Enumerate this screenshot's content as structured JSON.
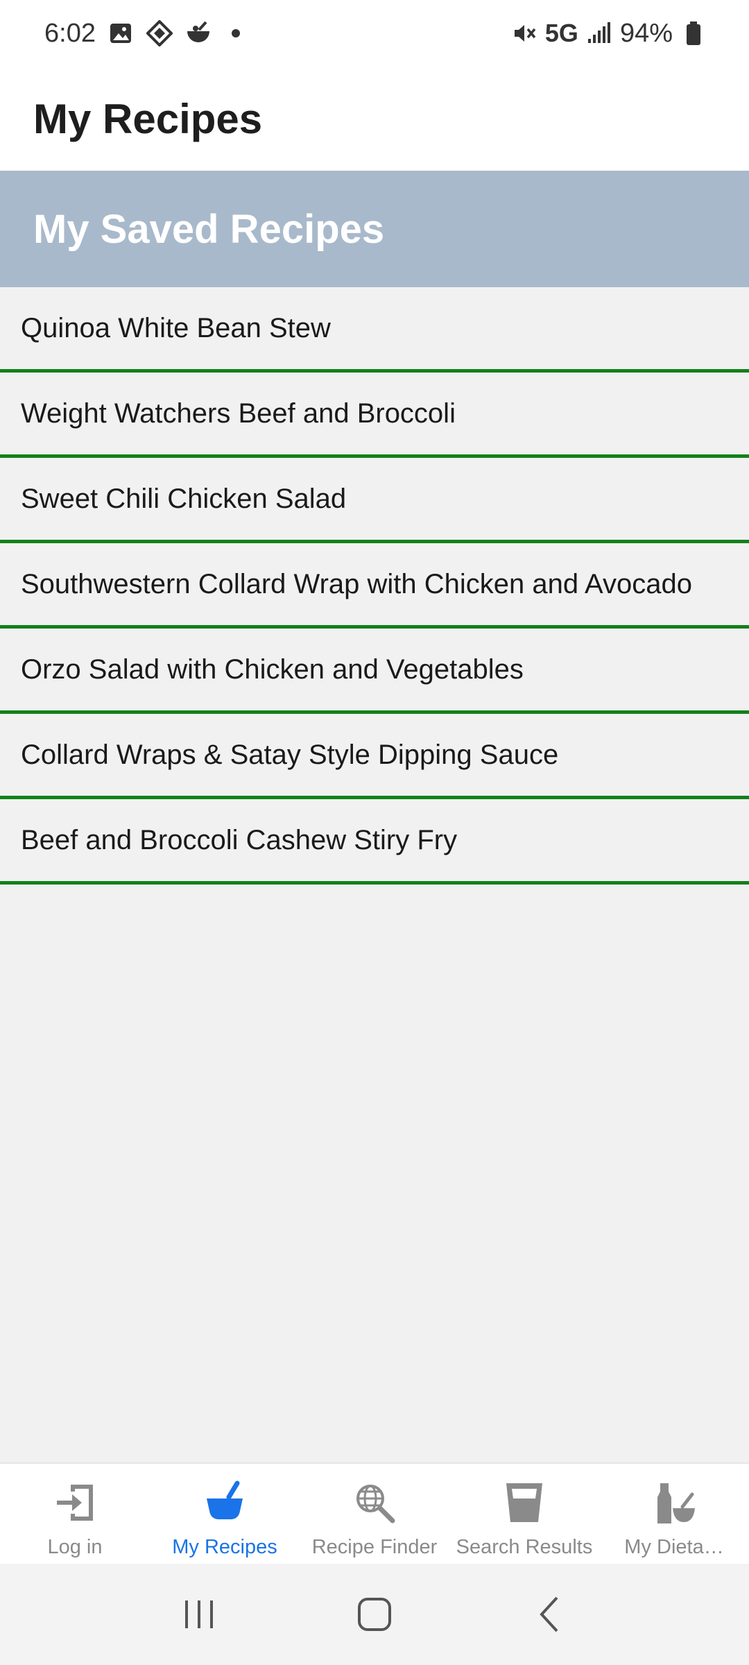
{
  "status_bar": {
    "time": "6:02",
    "network": "5G",
    "battery": "94%",
    "left_icons": [
      "gallery-icon",
      "diamond-app-icon",
      "bowl-app-icon"
    ],
    "right_icons": [
      "mute-icon",
      "signal-icon",
      "battery-icon"
    ]
  },
  "header": {
    "title": "My Recipes"
  },
  "section": {
    "title": "My Saved Recipes"
  },
  "recipes": [
    "Quinoa White Bean Stew",
    "Weight Watchers Beef and Broccoli",
    "Sweet Chili Chicken Salad",
    "Southwestern Collard Wrap with Chicken and Avocado",
    "Orzo Salad with Chicken and Vegetables",
    "Collard Wraps & Satay Style Dipping Sauce",
    "Beef and Broccoli Cashew Stiry Fry"
  ],
  "tabs": [
    {
      "label": "Log in",
      "icon": "login-icon",
      "active": false
    },
    {
      "label": "My Recipes",
      "icon": "mortar-pestle-icon",
      "active": true
    },
    {
      "label": "Recipe Finder",
      "icon": "globe-search-icon",
      "active": false
    },
    {
      "label": "Search Results",
      "icon": "glass-icon",
      "active": false
    },
    {
      "label": "My Dieta…",
      "icon": "bottle-bowl-icon",
      "active": false
    }
  ],
  "colors": {
    "banner": "#a8b9cb",
    "divider": "#13801a",
    "active_tab": "#1a73e8",
    "inactive_tab": "#8a8a8a"
  },
  "system_nav": [
    "recents-icon",
    "home-icon",
    "back-icon"
  ]
}
